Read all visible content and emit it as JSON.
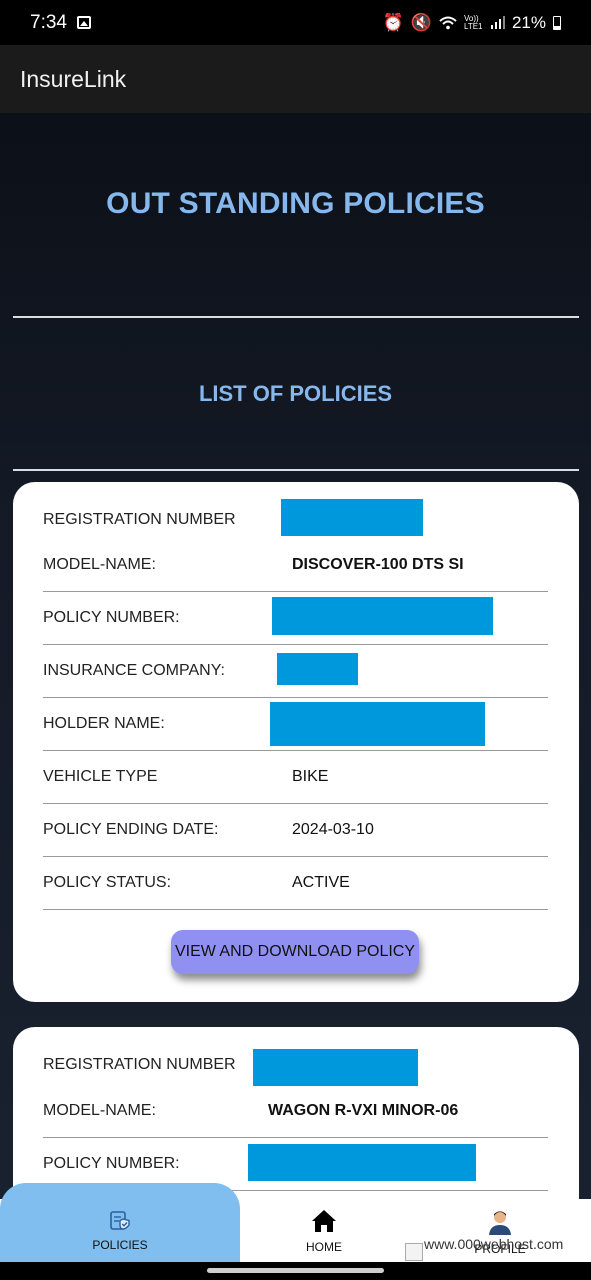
{
  "status_bar": {
    "time": "7:34",
    "battery": "21%",
    "network_label": "Vo)) LTE1"
  },
  "app_bar": {
    "title": "InsureLink"
  },
  "page": {
    "title": "OUT STANDING POLICIES",
    "list_title": "LIST OF POLICIES"
  },
  "policies": [
    {
      "labels": {
        "registration": "REGISTRATION NUMBER",
        "model": "MODEL-NAME:",
        "policy_number": "POLICY NUMBER:",
        "company": "INSURANCE COMPANY:",
        "holder": "HOLDER NAME:",
        "vehicle_type": "VEHICLE TYPE",
        "end_date": "POLICY ENDING DATE:",
        "status": "POLICY STATUS:"
      },
      "model": "DISCOVER-100 DTS SI",
      "vehicle_type": "BIKE",
      "end_date": "2024-03-10",
      "status": "ACTIVE",
      "button": "VIEW AND DOWNLOAD POLICY"
    },
    {
      "labels": {
        "registration": "REGISTRATION NUMBER",
        "model": "MODEL-NAME:",
        "policy_number": "POLICY NUMBER:"
      },
      "model": "WAGON R-VXI MINOR-06"
    }
  ],
  "bottom_nav": {
    "items": [
      {
        "label": "POLICIES",
        "icon": "policy-shield-icon",
        "active": true
      },
      {
        "label": "HOME",
        "icon": "home-icon",
        "active": false
      },
      {
        "label": "PROFILE",
        "icon": "profile-avatar-icon",
        "active": false
      }
    ],
    "ad_url": "www.000webhost.com"
  },
  "colors": {
    "accent_title": "#86b8ee",
    "redaction": "#0098dc",
    "button": "#9090f2",
    "nav_active": "#80bef0"
  }
}
